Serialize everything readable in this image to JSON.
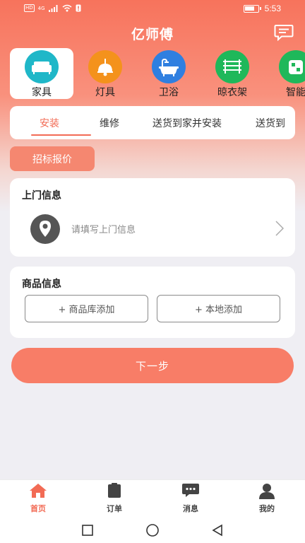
{
  "status_bar": {
    "left_chip": "HD",
    "network": "4G",
    "time": "5:53"
  },
  "header": {
    "title": "亿师傅",
    "message_icon": "message-icon"
  },
  "categories": [
    {
      "label": "家具",
      "icon": "sofa-icon",
      "color": "#1fb7c8",
      "active": true
    },
    {
      "label": "灯具",
      "icon": "lamp-icon",
      "color": "#f4921c",
      "active": false
    },
    {
      "label": "卫浴",
      "icon": "bathtub-icon",
      "color": "#2f7fe0",
      "active": false
    },
    {
      "label": "晾衣架",
      "icon": "clothes-rack-icon",
      "color": "#1fb85a",
      "active": false
    },
    {
      "label": "智能",
      "icon": "smart-device-icon",
      "color": "#1fb85a",
      "active": false
    }
  ],
  "tabs": [
    {
      "label": "安装",
      "active": true
    },
    {
      "label": "维修",
      "active": false
    },
    {
      "label": "送货到家并安装",
      "active": false
    },
    {
      "label": "送货到",
      "active": false
    }
  ],
  "bid_button": "招标报价",
  "visit_info": {
    "title": "上门信息",
    "placeholder": "请填写上门信息"
  },
  "goods_info": {
    "title": "商品信息",
    "add_from_library": "+ 商品库添加",
    "add_local": "+ 本地添加"
  },
  "next_button": "下一步",
  "bottom_nav": [
    {
      "label": "首页",
      "icon": "home-icon",
      "active": true
    },
    {
      "label": "订单",
      "icon": "order-icon",
      "active": false
    },
    {
      "label": "消息",
      "icon": "chat-icon",
      "active": false
    },
    {
      "label": "我的",
      "icon": "profile-icon",
      "active": false
    }
  ],
  "colors": {
    "brand": "#f26b55",
    "accent_button": "#f87d67"
  }
}
